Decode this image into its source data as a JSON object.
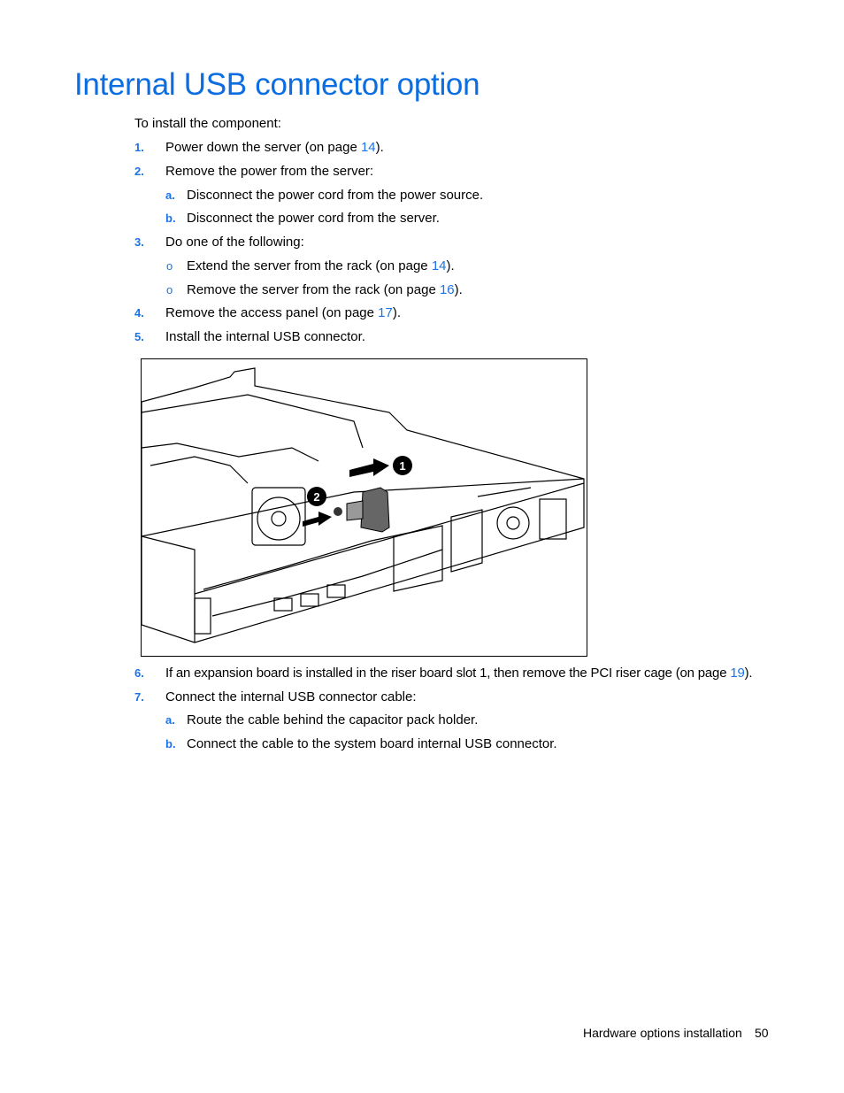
{
  "page": {
    "title": "Internal USB connector option",
    "intro": "To install the component:",
    "steps": [
      {
        "num": "1.",
        "pre": "Power down the server (on page ",
        "link": "14",
        "post": ")."
      },
      {
        "num": "2.",
        "text": "Remove the power from the server:",
        "substeps": [
          {
            "num": "a.",
            "text": "Disconnect the power cord from the power source."
          },
          {
            "num": "b.",
            "text": "Disconnect the power cord from the server."
          }
        ]
      },
      {
        "num": "3.",
        "text": "Do one of the following:",
        "bullets": [
          {
            "marker": "o",
            "pre": "Extend the server from the rack (on page ",
            "link": "14",
            "post": ")."
          },
          {
            "marker": "o",
            "pre": "Remove the server from the rack (on page ",
            "link": "16",
            "post": ")."
          }
        ]
      },
      {
        "num": "4.",
        "pre": "Remove the access panel (on page ",
        "link": "17",
        "post": ")."
      },
      {
        "num": "5.",
        "text": "Install the internal USB connector."
      },
      {
        "num": "6.",
        "pre": "If an expansion board is installed in the riser board slot 1, then remove the PCI riser cage (on page ",
        "link": "19",
        "post": ")."
      },
      {
        "num": "7.",
        "text": "Connect the internal USB connector cable:",
        "substeps": [
          {
            "num": "a.",
            "text": "Route the cable behind the capacitor pack holder."
          },
          {
            "num": "b.",
            "text": "Connect the cable to the system board internal USB connector."
          }
        ]
      }
    ],
    "figure": {
      "callouts": [
        "1",
        "2"
      ]
    },
    "footer": {
      "section": "Hardware options installation",
      "page_number": "50"
    }
  }
}
